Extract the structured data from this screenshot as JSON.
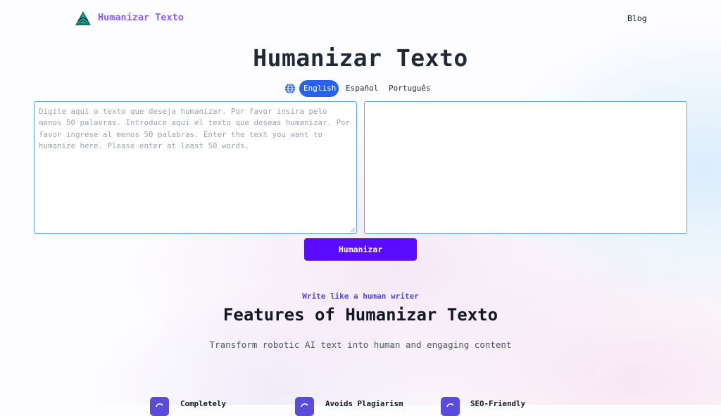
{
  "header": {
    "brand": "Humanizar Texto",
    "nav_blog": "Blog"
  },
  "hero": {
    "title": "Humanizar Texto"
  },
  "languages": {
    "icon": "globe-icon",
    "options": [
      "English",
      "Español",
      "Português"
    ],
    "selected": "English"
  },
  "editor": {
    "input_placeholder": "Digite aqui o texto que deseja humanizar. Por favor insira pelo menos 50 palavras. Introduce aquí el texto que deseas humanizar. Por favor ingrese al menos 50 palabras. Enter the text you want to humanize here. Please enter at least 50 words.",
    "input_value": "",
    "output_value": ""
  },
  "actions": {
    "humanize_label": "Humanizar"
  },
  "features": {
    "eyebrow": "Write like a human writer",
    "title": "Features of Humanizar Texto",
    "subtitle": "Transform robotic AI text into human and engaging content",
    "items": [
      {
        "label": "Completely",
        "icon": "refresh-icon"
      },
      {
        "label": "Avoids Plagiarism",
        "icon": "refresh-icon"
      },
      {
        "label": "SEO-Friendly",
        "icon": "refresh-icon"
      }
    ]
  },
  "colors": {
    "brand": "#8b5cf6",
    "primary_button": "#5b0cff",
    "active_lang": "#2563eb",
    "box_border": "#60a5fa",
    "eyebrow": "#4f46e5"
  }
}
